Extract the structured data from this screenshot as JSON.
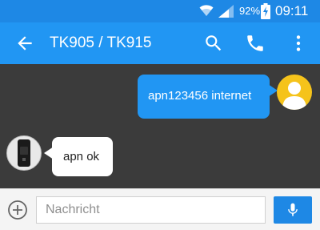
{
  "status_bar": {
    "battery_percent": "92%",
    "time": "09:11"
  },
  "app_bar": {
    "title": "TK905 / TK915"
  },
  "messages": [
    {
      "direction": "outgoing",
      "text": "apn123456 internet"
    },
    {
      "direction": "incoming",
      "text": "apn ok"
    }
  ],
  "composer": {
    "placeholder": "Nachricht"
  },
  "icons": {
    "status": [
      "wifi-icon",
      "signal-icon",
      "battery-charging-icon"
    ],
    "app_bar": [
      "back-arrow-icon",
      "search-icon",
      "phone-icon",
      "more-vert-icon"
    ],
    "composer": [
      "add-circle-icon",
      "microphone-icon"
    ]
  },
  "colors": {
    "primary": "#2196f3",
    "status_bar": "#1e88e5",
    "chat_background": "#3b3b3b",
    "user_avatar": "#f5c31b"
  }
}
